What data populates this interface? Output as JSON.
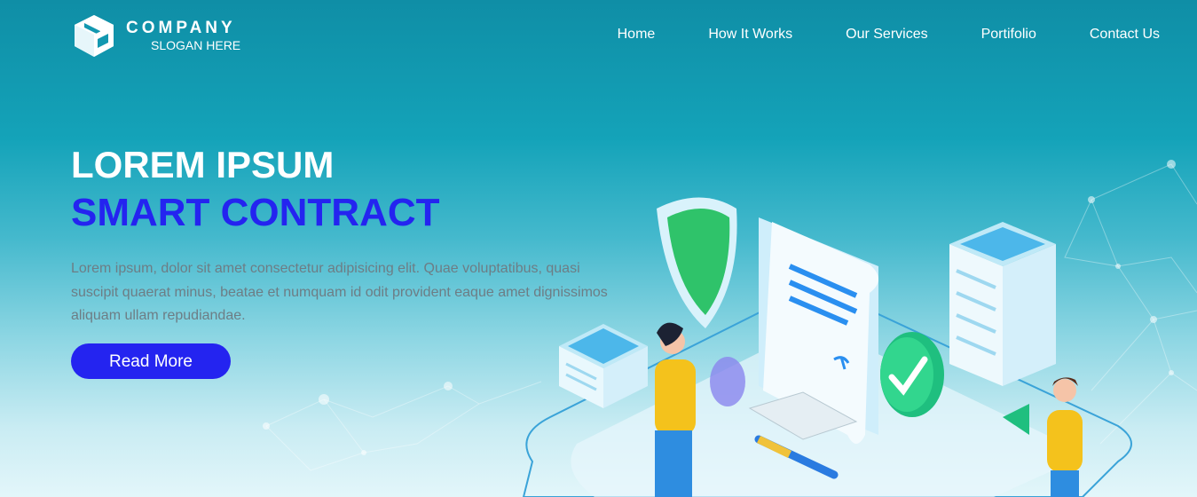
{
  "brand": {
    "name": "COMPANY",
    "slogan": "SLOGAN HERE"
  },
  "nav": {
    "items": [
      {
        "label": "Home"
      },
      {
        "label": "How It Works"
      },
      {
        "label": "Our Services"
      },
      {
        "label": "Portifolio"
      },
      {
        "label": "Contact Us"
      }
    ]
  },
  "hero": {
    "title_line1": "LOREM IPSUM",
    "title_line2": "SMART CONTRACT",
    "description": "Lorem ipsum, dolor sit amet consectetur adipisicing elit. Quae voluptatibus, quasi suscipit quaerat minus, beatae et numquam id odit provident eaque amet dignissimos aliquam ullam repudiandae.",
    "button_label": "Read More"
  },
  "colors": {
    "accent": "#2424f0",
    "header_bg": "#0f8ea6",
    "text_muted": "#6d7d85"
  },
  "icons": [
    "box-logo-icon"
  ]
}
